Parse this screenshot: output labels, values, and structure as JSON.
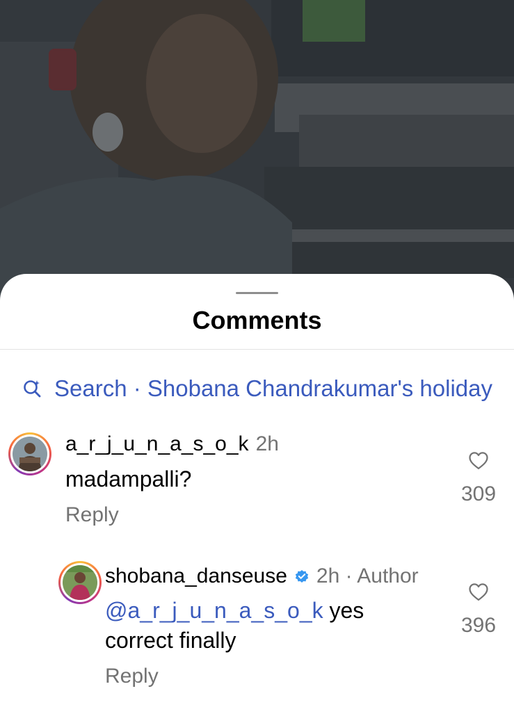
{
  "sheet": {
    "title": "Comments"
  },
  "search": {
    "text": "Search · Shobana Chandrakumar's holiday"
  },
  "comments": [
    {
      "username": "a_r_j_u_n_a_s_o_k",
      "time": "2h",
      "text": "madampalli?",
      "reply_label": "Reply",
      "like_count": "309",
      "avatar_icon": "avatar"
    },
    {
      "username": "shobana_danseuse",
      "verified": true,
      "time_author": "2h · Author",
      "mention": "@a_r_j_u_n_a_s_o_k",
      "text_rest": " yes",
      "text_line2": "correct finally",
      "reply_label": "Reply",
      "like_count": "396",
      "avatar_icon": "avatar"
    }
  ],
  "colors": {
    "link": "#3b5bbd",
    "muted": "#737373",
    "verified": "#3797f0"
  }
}
